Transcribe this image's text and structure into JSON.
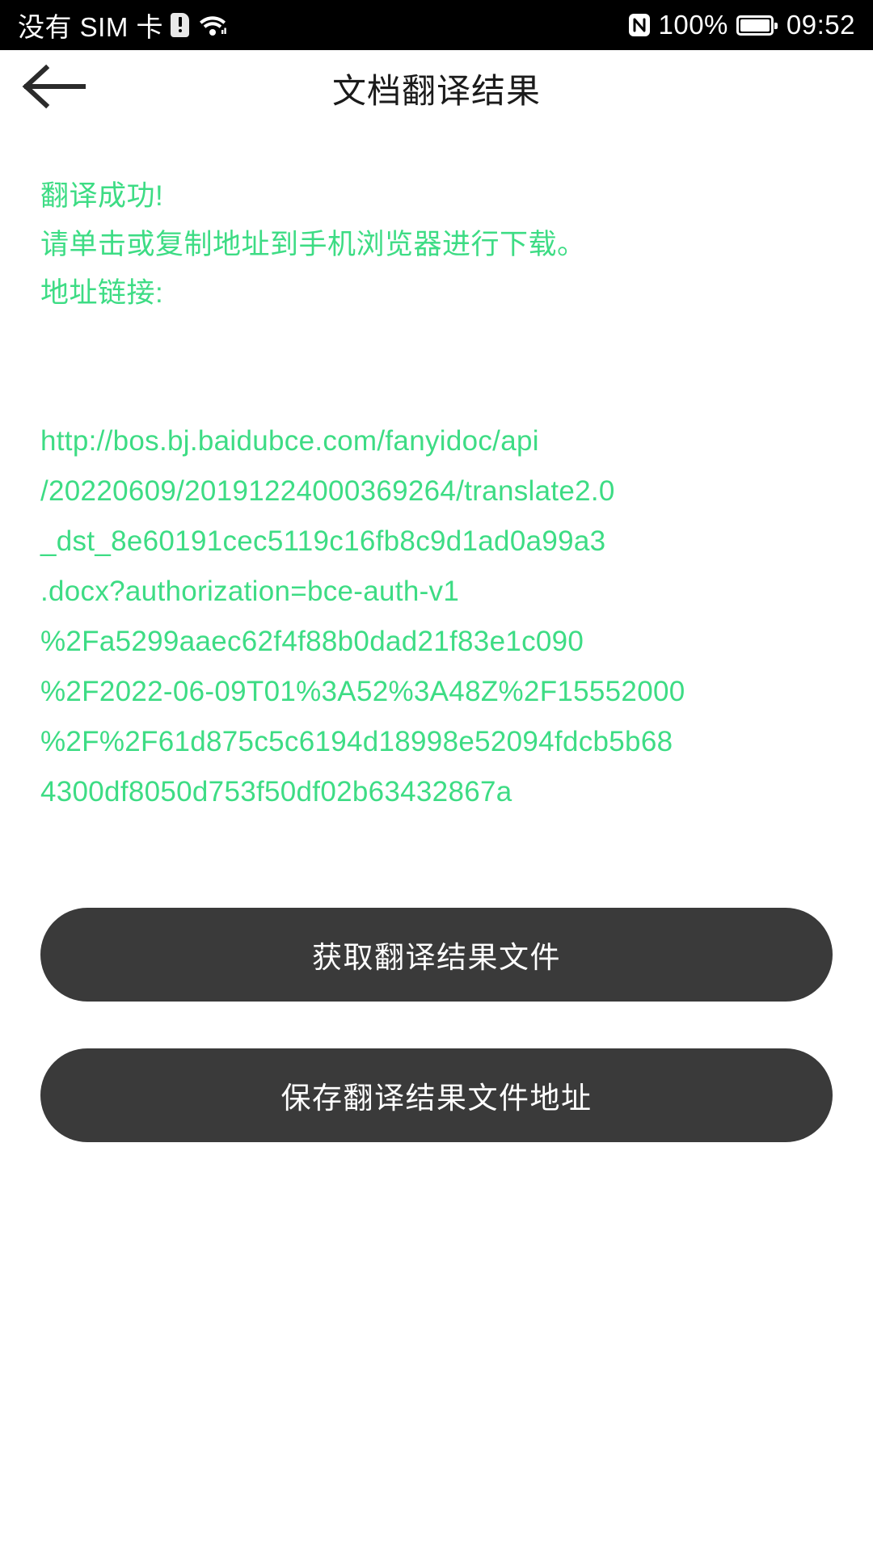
{
  "status_bar": {
    "carrier_text": "没有 SIM 卡",
    "sim_icon": "sim-card-alert-icon",
    "wifi_icon": "wifi-icon",
    "nfc_icon": "nfc-icon",
    "battery_percent": "100%",
    "battery_icon": "battery-full-icon",
    "time": "09:52",
    "background_color": "#000000",
    "foreground_color": "#ffffff"
  },
  "title_bar": {
    "back_icon": "arrow-left-icon",
    "title": "文档翻译结果"
  },
  "notice": {
    "line1": "翻译成功!",
    "line2": "请单击或复制地址到手机浏览器进行下载。",
    "line3": "地址链接:",
    "color": "#3ddc84"
  },
  "url": {
    "full": "http://bos.bj.baidubce.com/fanyidoc/api/20220609/20191224000369264/translate2.0_dst_8e60191cec5119c16fb8c9d1ad0a99a3.docx?authorization=bce-auth-v1%2Fa5299aaec62f4f88b0dad21f83e1c090%2F2022-06-09T01%3A52%3A48Z%2F15552000%2F%2F61d875c5c6194d18998e52094fdcb5b684300df8050d753f50df02b63432867a",
    "lines": [
      "http://bos.bj.baidubce.com/fanyidoc/api",
      "/20220609/20191224000369264/translate2.0",
      "_dst_8e60191cec5119c16fb8c9d1ad0a99a3",
      ".docx?authorization=bce-auth-v1",
      "%2Fa5299aaec62f4f88b0dad21f83e1c090",
      "%2F2022-06-09T01%3A52%3A48Z%2F15552000",
      "%2F%2F61d875c5c6194d18998e52094fdcb5b68",
      "4300df8050d753f50df02b63432867a"
    ],
    "color": "#3ddc84"
  },
  "buttons": {
    "get_file": "获取翻译结果文件",
    "save_address": "保存翻译结果文件地址",
    "background_color": "#3a3a3a",
    "text_color": "#ffffff"
  }
}
